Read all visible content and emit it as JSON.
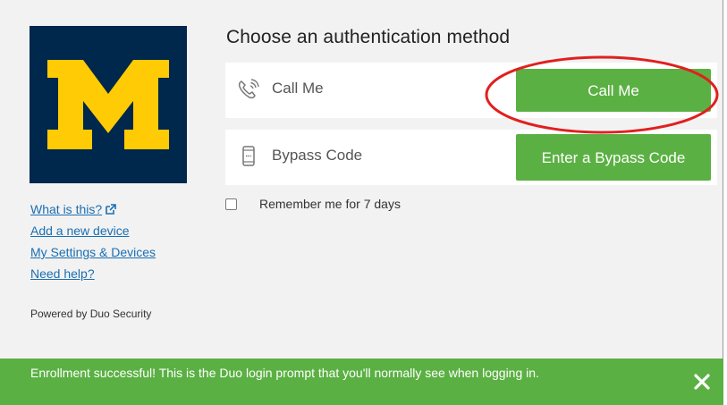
{
  "prompt": {
    "title": "Choose an authentication method"
  },
  "methods": [
    {
      "label": "Call Me",
      "icon": "phone-call-icon",
      "button_label": "Call Me"
    },
    {
      "label": "Bypass Code",
      "icon": "device-icon",
      "button_label": "Enter a Bypass Code"
    }
  ],
  "remember": {
    "label": "Remember me for 7 days",
    "checked": false
  },
  "sidebar": {
    "logo": "university-of-michigan-block-m-logo",
    "links": [
      "What is this?",
      "Add a new device",
      "My Settings & Devices",
      "Need help?"
    ],
    "powered_by": "Powered by Duo Security"
  },
  "banner": {
    "message": "Enrollment successful! This is the Duo login prompt that you'll normally see when logging in.",
    "close_icon": "close-icon"
  },
  "colors": {
    "accent_green": "#5bb043",
    "logo_background": "#00274c",
    "logo_maize": "#ffcb05",
    "link_blue": "#1a6fb3",
    "annotation_red": "#e0201f"
  }
}
